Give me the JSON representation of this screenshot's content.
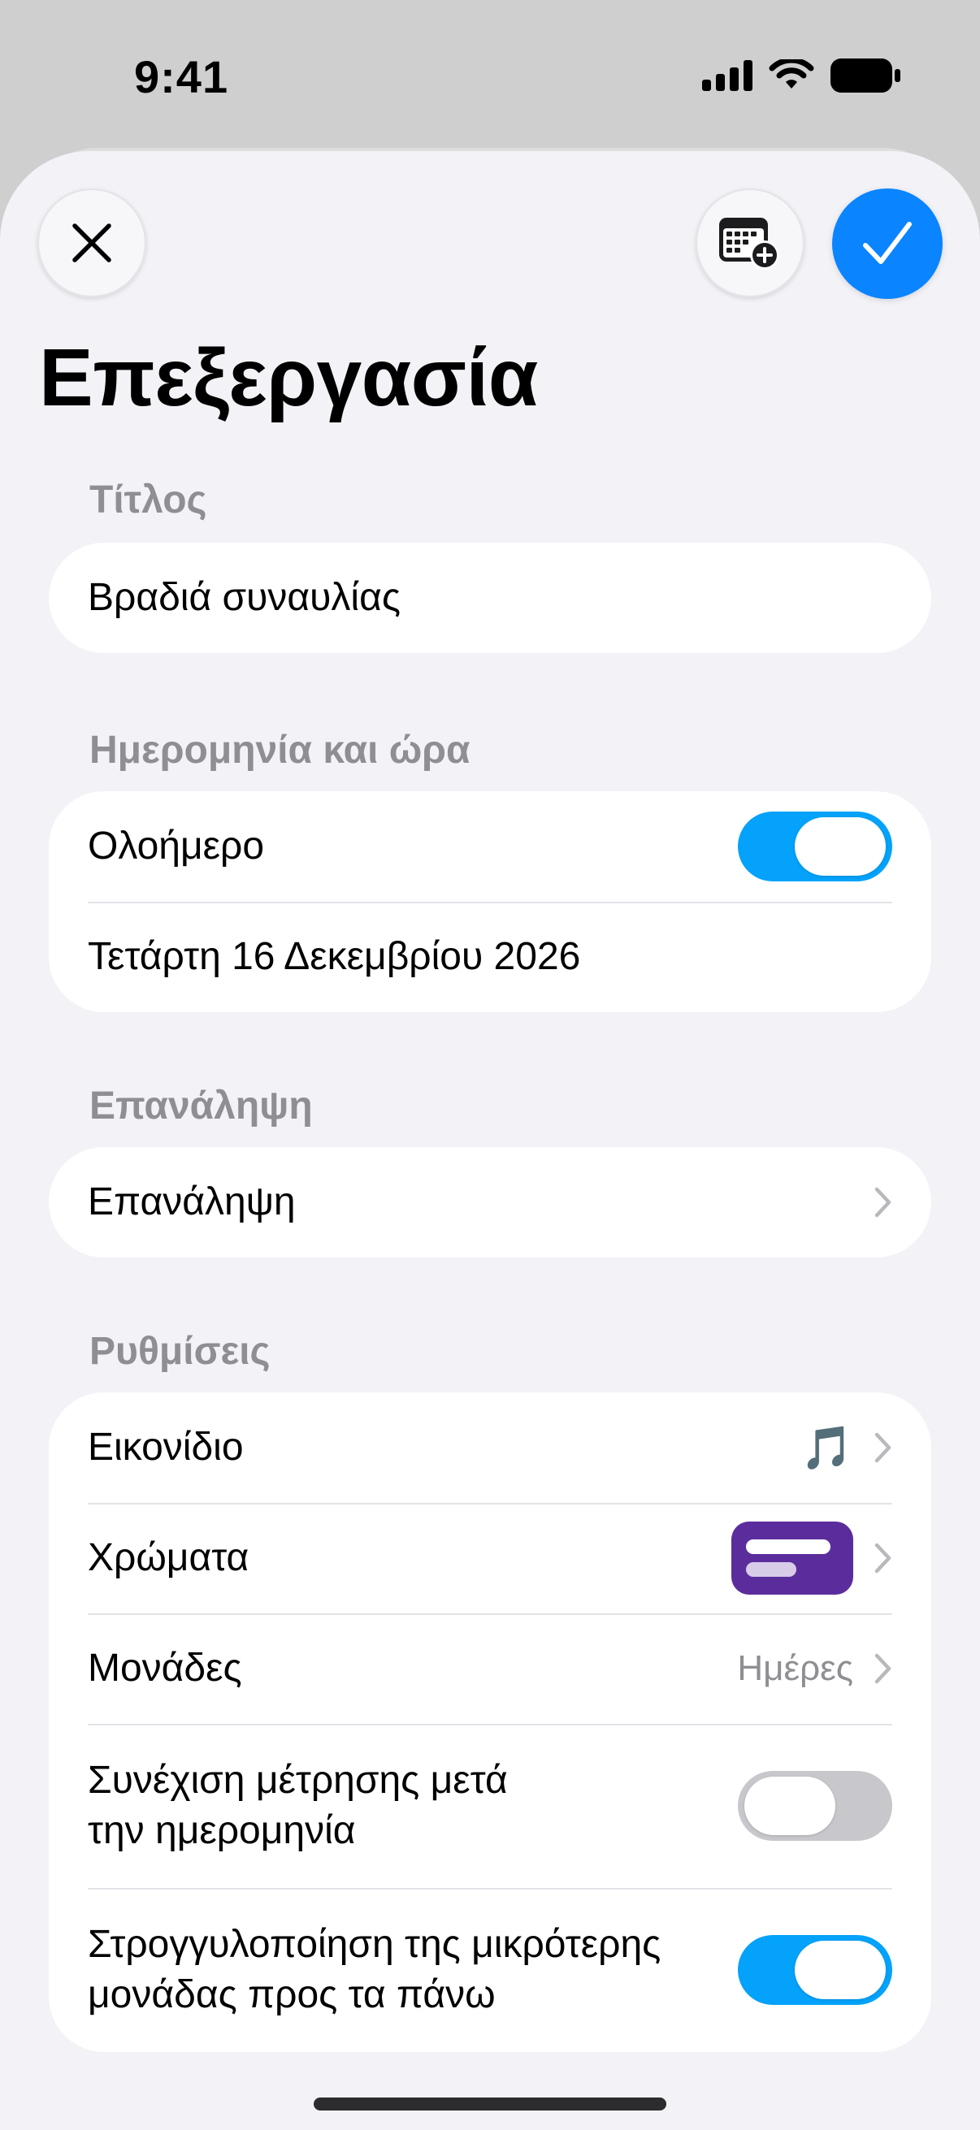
{
  "status_bar": {
    "time": "9:41"
  },
  "header": {
    "title": "Επεξεργασία",
    "close_icon": "close-icon",
    "calendar_icon": "calendar-add-icon",
    "confirm_icon": "checkmark-icon"
  },
  "title_section": {
    "header": "Τίτλος",
    "value": "Βραδιά συναυλίας"
  },
  "date_section": {
    "header": "Ημερομηνία και ώρα",
    "all_day_label": "Ολοήμερο",
    "all_day_on": true,
    "date_value": "Τετάρτη 16 Δεκεμβρίου 2026"
  },
  "repeat_section": {
    "header": "Επανάληψη",
    "row_label": "Επανάληψη"
  },
  "settings_section": {
    "header": "Ρυθμίσεις",
    "icon_label": "Εικονίδιο",
    "icon_value": "🎵",
    "colors_label": "Χρώματα",
    "color_value": "#5b2d9c",
    "units_label": "Μονάδες",
    "units_value": "Ημέρες",
    "continue_line1": "Συνέχιση μέτρησης μετά",
    "continue_line2": "την ημερομηνία",
    "continue_on": false,
    "round_line1": "Στρογγυλοποίηση της μικρότερης",
    "round_line2": "μονάδας προς τα πάνω",
    "round_on": true
  },
  "colors": {
    "accent": "#0a84ff",
    "toggle_on": "#04a2fa",
    "toggle_off": "#c7c7cc",
    "background": "#f2f2f7"
  }
}
